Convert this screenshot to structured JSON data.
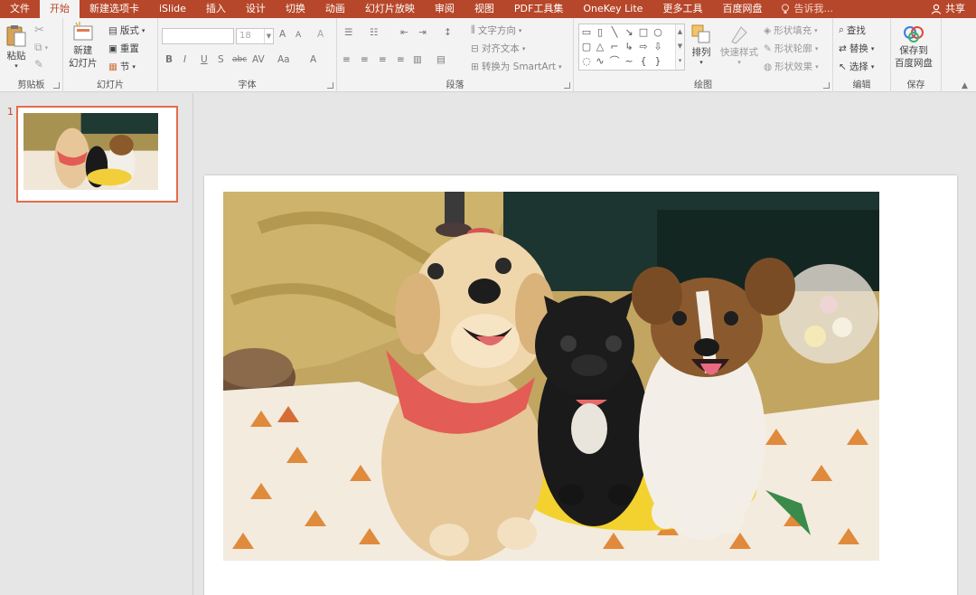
{
  "tabs": [
    {
      "label": "文件",
      "active": false
    },
    {
      "label": "开始",
      "active": true
    },
    {
      "label": "新建选项卡",
      "active": false
    },
    {
      "label": "iSlide",
      "active": false
    },
    {
      "label": "插入",
      "active": false
    },
    {
      "label": "设计",
      "active": false
    },
    {
      "label": "切换",
      "active": false
    },
    {
      "label": "动画",
      "active": false
    },
    {
      "label": "幻灯片放映",
      "active": false
    },
    {
      "label": "审阅",
      "active": false
    },
    {
      "label": "视图",
      "active": false
    },
    {
      "label": "PDF工具集",
      "active": false
    },
    {
      "label": "OneKey Lite",
      "active": false
    },
    {
      "label": "更多工具",
      "active": false
    },
    {
      "label": "百度网盘",
      "active": false
    }
  ],
  "tell_me": "告诉我...",
  "share": "共享",
  "ribbon": {
    "clipboard": {
      "paste": "粘贴",
      "label": "剪贴板"
    },
    "slides": {
      "new_slide": "新建\n幻灯片",
      "new_slide_1": "新建",
      "new_slide_2": "幻灯片",
      "layout": "版式",
      "reset": "重置",
      "section": "节",
      "label": "幻灯片"
    },
    "font": {
      "font_name": "",
      "font_size": "18",
      "label": "字体",
      "grow": "A",
      "shrink": "A",
      "clear": "A",
      "bold": "B",
      "italic": "I",
      "underline": "U",
      "shadow": "S",
      "strike": "abc",
      "spacing": "AV",
      "case": "Aa",
      "color": "A"
    },
    "paragraph": {
      "text_direction": "文字方向",
      "align_text": "对齐文本",
      "smartart": "转换为 SmartArt",
      "label": "段落"
    },
    "drawing": {
      "arrange": "排列",
      "quick_styles": "快速样式",
      "shape_fill": "形状填充",
      "shape_outline": "形状轮廓",
      "shape_effects": "形状效果",
      "label": "绘图"
    },
    "editing": {
      "find": "查找",
      "replace": "替换",
      "select": "选择",
      "label": "编辑"
    },
    "save": {
      "save_to": "保存到",
      "save_to_2": "百度网盘",
      "label": "保存"
    }
  },
  "thumbnails": [
    {
      "number": "1"
    }
  ],
  "colors": {
    "accent": "#b7472a",
    "thumb_border": "#e46c4c",
    "ribbon_bg": "#f3f3f3",
    "workspace_bg": "#e6e6e6"
  },
  "image": {
    "description_icon": "photo-three-dogs"
  }
}
